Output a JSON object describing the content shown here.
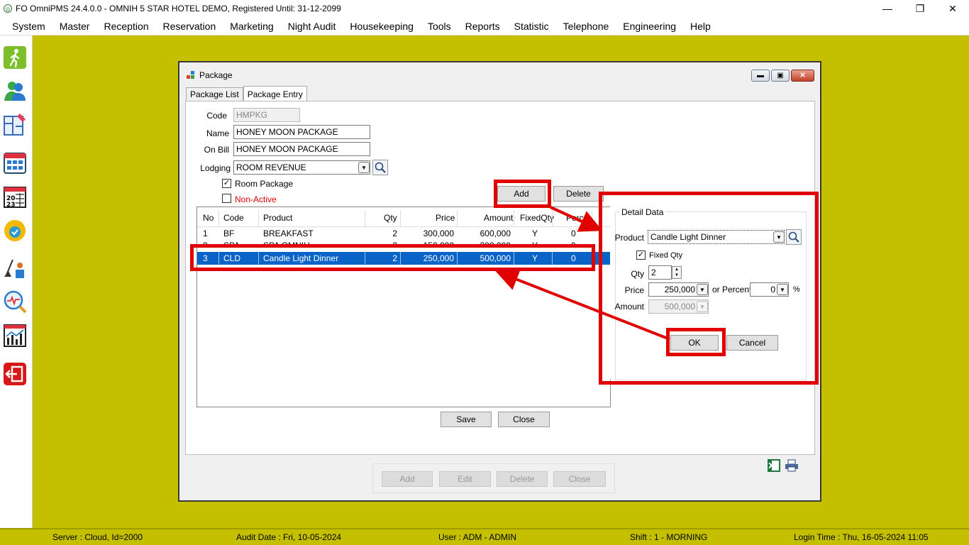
{
  "app": {
    "title": "FO OmniPMS 24.4.0.0 - OMNIH 5 STAR HOTEL DEMO, Registered Until: 31-12-2099",
    "window_controls": [
      "minimize",
      "restore",
      "close"
    ]
  },
  "menu": [
    "System",
    "Master",
    "Reception",
    "Reservation",
    "Marketing",
    "Night Audit",
    "Housekeeping",
    "Tools",
    "Reports",
    "Statistic",
    "Telephone",
    "Engineering",
    "Help"
  ],
  "toolbar_icons": [
    "walk-in-icon",
    "guests-icon",
    "floor-plan-icon",
    "calendar-icon",
    "calendar-2023-icon",
    "availability-icon",
    "housekeeping-icon",
    "search-analytics-icon",
    "statistics-chart-icon",
    "logout-icon"
  ],
  "package_window": {
    "title": "Package",
    "tabs": [
      "Package List",
      "Package Entry"
    ],
    "active_tab": "Package Entry",
    "form": {
      "code_label": "Code",
      "code_value": "HMPKG",
      "name_label": "Name",
      "name_value": "HONEY MOON PACKAGE",
      "onbill_label": "On Bill",
      "onbill_value": "HONEY MOON PACKAGE",
      "lodging_label": "Lodging",
      "lodging_value": "ROOM REVENUE",
      "room_package_label": "Room Package",
      "room_package_checked": true,
      "non_active_label": "Non-Active",
      "non_active_checked": false,
      "non_active_color": "#e00000"
    },
    "buttons": {
      "add": "Add",
      "delete": "Delete",
      "save": "Save",
      "close": "Close"
    },
    "grid": {
      "columns": [
        "No",
        "Code",
        "Product",
        "Qty",
        "Price",
        "Amount",
        "FixedQty",
        "Perc"
      ],
      "rows": [
        {
          "no": "1",
          "code": "BF",
          "product": "BREAKFAST",
          "qty": "2",
          "price": "300,000",
          "amount": "600,000",
          "fixed": "Y",
          "perc": "0"
        },
        {
          "no": "2",
          "code": "SPA",
          "product": "SPA OMNIH",
          "qty": "2",
          "price": "150,000",
          "amount": "300,000",
          "fixed": "Y",
          "perc": "0"
        },
        {
          "no": "3",
          "code": "CLD",
          "product": "Candle Light Dinner",
          "qty": "2",
          "price": "250,000",
          "amount": "500,000",
          "fixed": "Y",
          "perc": "0"
        }
      ],
      "selected_row_color": "#0a64c8"
    },
    "detail": {
      "group_label": "Detail Data",
      "product_label": "Product",
      "product_value": "Candle Light Dinner",
      "fixed_qty_label": "Fixed Qty",
      "fixed_qty_checked": true,
      "qty_label": "Qty",
      "qty_value": "2",
      "price_label": "Price",
      "price_value": "250,000",
      "percent_label": "or Percent",
      "percent_value": "0",
      "percent_sign": "%",
      "amount_label": "Amount",
      "amount_value": "500,000",
      "ok": "OK",
      "cancel": "Cancel"
    },
    "bottom_buttons": {
      "add": "Add",
      "edit": "Edit",
      "delete": "Delete",
      "close": "Close"
    },
    "bottom_icons": [
      "excel-export-icon",
      "print-icon"
    ]
  },
  "status": {
    "server": "Server : Cloud, Id=2000",
    "audit_date": "Audit Date : Fri, 10-05-2024",
    "user": "User : ADM - ADMIN",
    "shift": "Shift : 1 - MORNING",
    "login_time": "Login Time : Thu, 16-05-2024 11:05"
  },
  "annotation_color": "#e00000",
  "accent_bg": "#c4c000"
}
